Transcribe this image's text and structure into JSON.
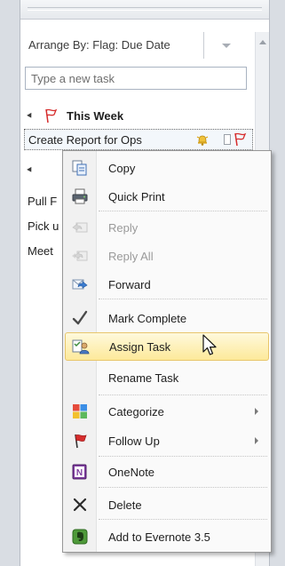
{
  "arrange": {
    "label": "Arrange By: Flag: Due Date"
  },
  "new_task": {
    "placeholder": "Type a new task"
  },
  "groups": [
    {
      "label": "This Week"
    }
  ],
  "selected_task": {
    "name": "Create Report for Ops"
  },
  "partial_items": [
    {
      "label": "Pull F"
    },
    {
      "label": "Pick u"
    },
    {
      "label": "Meet"
    }
  ],
  "menu": {
    "items": [
      {
        "label": "Copy",
        "icon": "copy-icon"
      },
      {
        "label": "Quick Print",
        "icon": "printer-icon"
      },
      {
        "label": "Reply",
        "icon": "reply-icon",
        "disabled": true
      },
      {
        "label": "Reply All",
        "icon": "reply-all-icon",
        "disabled": true
      },
      {
        "label": "Forward",
        "icon": "forward-icon"
      },
      {
        "label": "Mark Complete",
        "icon": "checkmark-icon"
      },
      {
        "label": "Assign Task",
        "icon": "assign-task-icon",
        "highlighted": true
      },
      {
        "label": "Rename Task",
        "icon": ""
      },
      {
        "label": "Categorize",
        "icon": "categorize-icon",
        "submenu": true
      },
      {
        "label": "Follow Up",
        "icon": "follow-up-flag-icon",
        "submenu": true
      },
      {
        "label": "OneNote",
        "icon": "onenote-icon"
      },
      {
        "label": "Delete",
        "icon": "delete-x-icon"
      },
      {
        "label": "Add to Evernote 3.5",
        "icon": "evernote-icon"
      }
    ]
  },
  "colors": {
    "highlight_top": "#fef9dc",
    "highlight_bottom": "#fde99a",
    "flag_red": "#d62d2d",
    "disabled_text": "#9a9a9a"
  }
}
